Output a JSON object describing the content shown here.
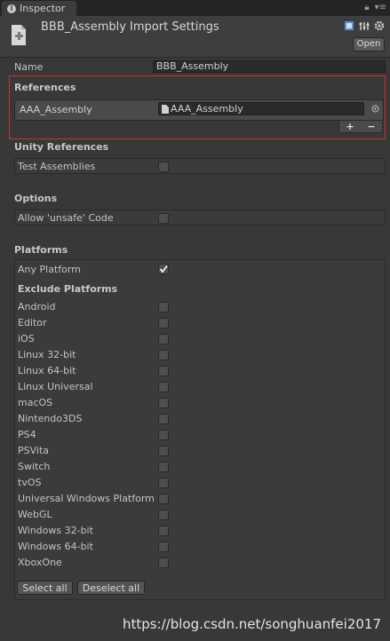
{
  "tab": {
    "title": "Inspector",
    "info_icon": "info-icon",
    "lock_icon": "lock-icon",
    "menu_icon": "menu-icon"
  },
  "header": {
    "title": "BBB_Assembly Import Settings",
    "open_label": "Open",
    "icons": [
      "help-book-icon",
      "preset-icon",
      "gear-icon"
    ]
  },
  "name_field": {
    "label": "Name",
    "value": "BBB_Assembly"
  },
  "references": {
    "title": "References",
    "items": [
      {
        "label": "AAA_Assembly",
        "value": "AAA_Assembly"
      }
    ],
    "add_label": "+",
    "remove_label": "−"
  },
  "unity_references": {
    "title": "Unity References",
    "test_assemblies_label": "Test Assemblies",
    "test_assemblies_checked": false
  },
  "options": {
    "title": "Options",
    "allow_unsafe_label": "Allow 'unsafe' Code",
    "allow_unsafe_checked": false
  },
  "platforms": {
    "title": "Platforms",
    "any_platform_label": "Any Platform",
    "any_platform_checked": true,
    "exclude_title": "Exclude Platforms",
    "list": [
      "Android",
      "Editor",
      "iOS",
      "Linux 32-bit",
      "Linux 64-bit",
      "Linux Universal",
      "macOS",
      "Nintendo3DS",
      "PS4",
      "PSVita",
      "Switch",
      "tvOS",
      "Universal Windows Platform",
      "WebGL",
      "Windows 32-bit",
      "Windows 64-bit",
      "XboxOne"
    ],
    "select_all_label": "Select all",
    "deselect_all_label": "Deselect all"
  },
  "watermark": "https://blog.csdn.net/songhuanfei2017",
  "colors": {
    "highlight_border": "#c83232",
    "background": "#383838"
  }
}
